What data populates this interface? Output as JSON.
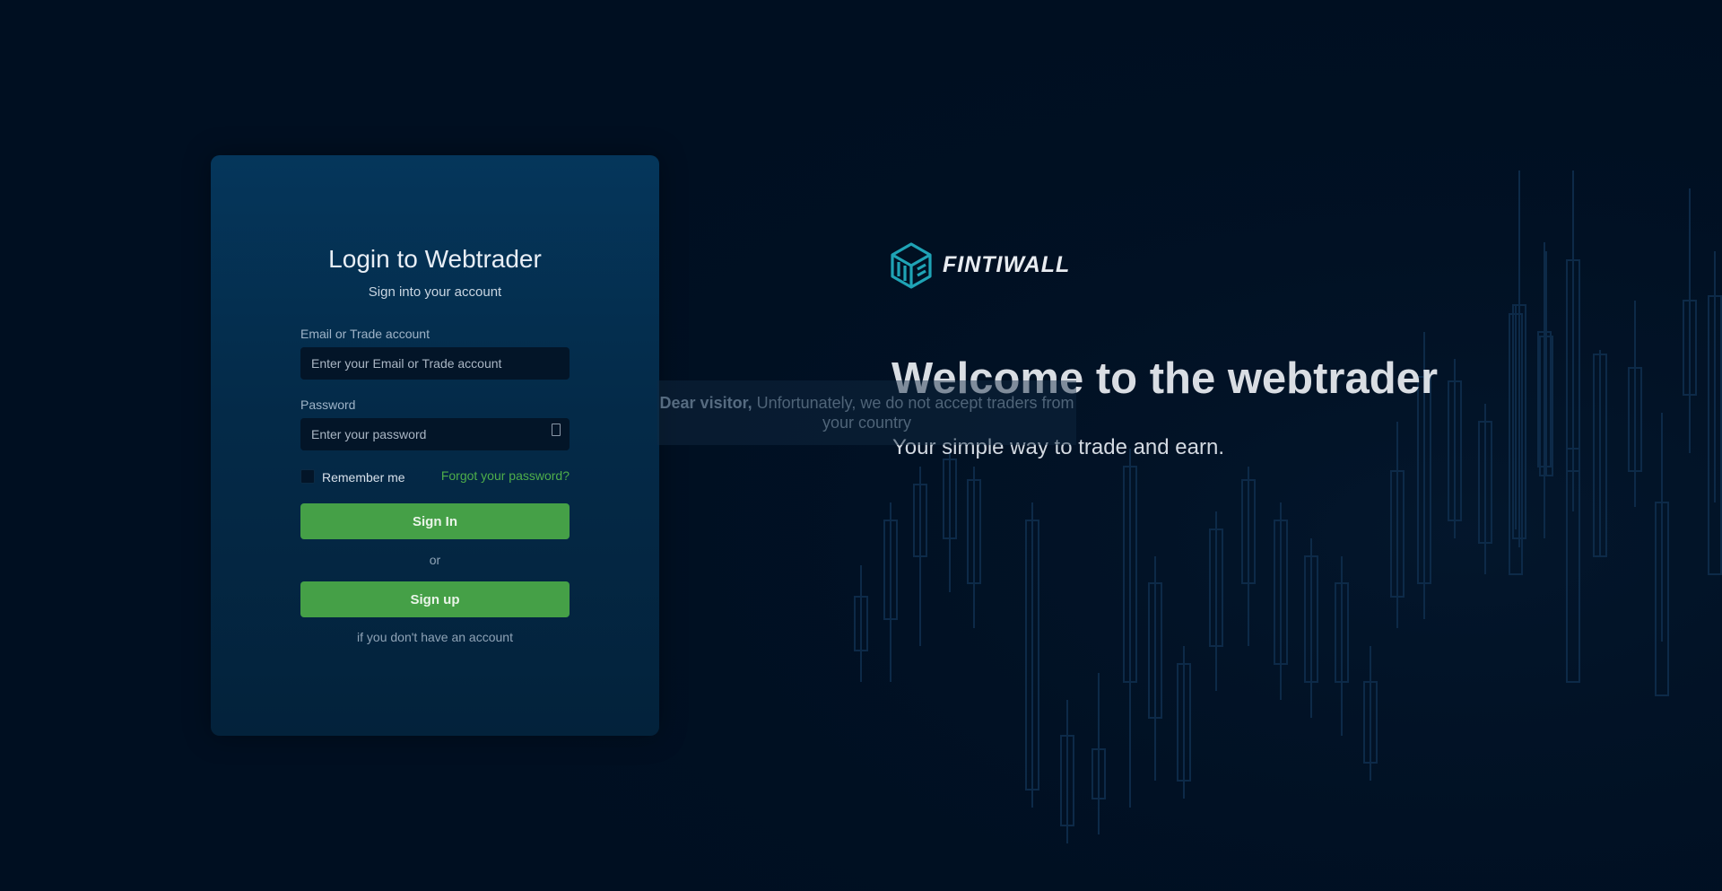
{
  "login": {
    "title": "Login to Webtrader",
    "subtitle": "Sign into your account",
    "email_label": "Email or Trade account",
    "email_placeholder": "Enter your Email or Trade account",
    "email_value": "",
    "password_label": "Password",
    "password_placeholder": "Enter your password",
    "password_value": "",
    "remember_label": "Remember me",
    "remember_checked": false,
    "forgot_link": "Forgot your password?",
    "signin_label": "Sign In",
    "or_text": "or",
    "signup_label": "Sign up",
    "signup_note": "if you don't have an account"
  },
  "notice": {
    "lead": "Dear visitor,",
    "text": "Unfortunately, we do not accept traders from your country"
  },
  "brand": {
    "logo_text": "FINTIWALL",
    "logo_icon": "cube-logo-icon",
    "welcome_title": "Welcome to the webtrader",
    "welcome_subtitle": "Your simple way to trade and earn."
  },
  "icons": {
    "password_toggle": "eye-icon"
  },
  "colors": {
    "background": "#000f21",
    "card": "#05365b",
    "accent_green": "#45a047",
    "link_green": "#4fae4a",
    "logo_teal": "#1fa3b5"
  }
}
